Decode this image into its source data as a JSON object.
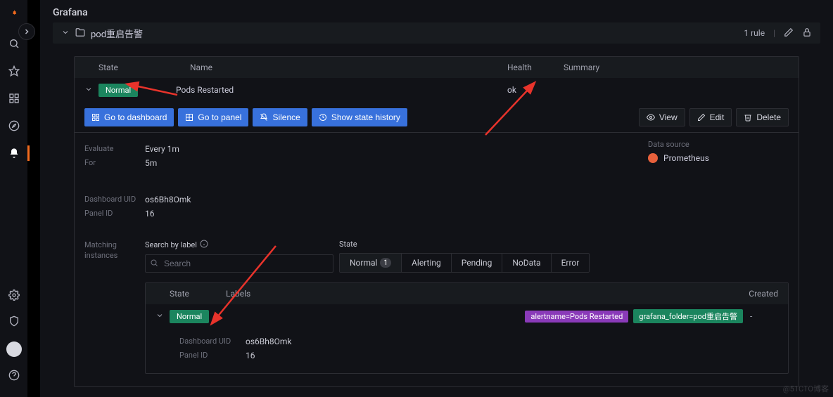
{
  "app": {
    "title": "Grafana"
  },
  "folder": {
    "name": "pod重启告警",
    "rule_count_label": "1 rule"
  },
  "table": {
    "headers": {
      "state": "State",
      "name": "Name",
      "health": "Health",
      "summary": "Summary"
    }
  },
  "rule": {
    "state": "Normal",
    "name": "Pods Restarted",
    "health": "ok",
    "summary": ""
  },
  "actions": {
    "dashboard": "Go to dashboard",
    "panel": "Go to panel",
    "silence": "Silence",
    "history": "Show state history",
    "view": "View",
    "edit": "Edit",
    "delete": "Delete"
  },
  "details": {
    "evaluate_k": "Evaluate",
    "evaluate_v": "Every 1m",
    "for_k": "For",
    "for_v": "5m",
    "dash_uid_k": "Dashboard UID",
    "dash_uid_v": "os6Bh8Omk",
    "panel_id_k": "Panel ID",
    "panel_id_v": "16",
    "ds_k": "Data source",
    "ds_v": "Prometheus"
  },
  "matching": {
    "label": "Matching instances",
    "search_label": "Search by label",
    "search_placeholder": "Search",
    "state_label": "State",
    "filters": {
      "normal": "Normal",
      "normal_count": "1",
      "alerting": "Alerting",
      "pending": "Pending",
      "nodata": "NoData",
      "error": "Error"
    }
  },
  "instances": {
    "headers": {
      "state": "State",
      "labels": "Labels",
      "created": "Created"
    },
    "row": {
      "state": "Normal",
      "label1": "alertname=Pods Restarted",
      "label2": "grafana_folder=pod重启告警",
      "created": "-"
    },
    "detail": {
      "dash_uid_k": "Dashboard UID",
      "dash_uid_v": "os6Bh8Omk",
      "panel_id_k": "Panel ID",
      "panel_id_v": "16"
    }
  },
  "watermark": "@51CTO博客"
}
